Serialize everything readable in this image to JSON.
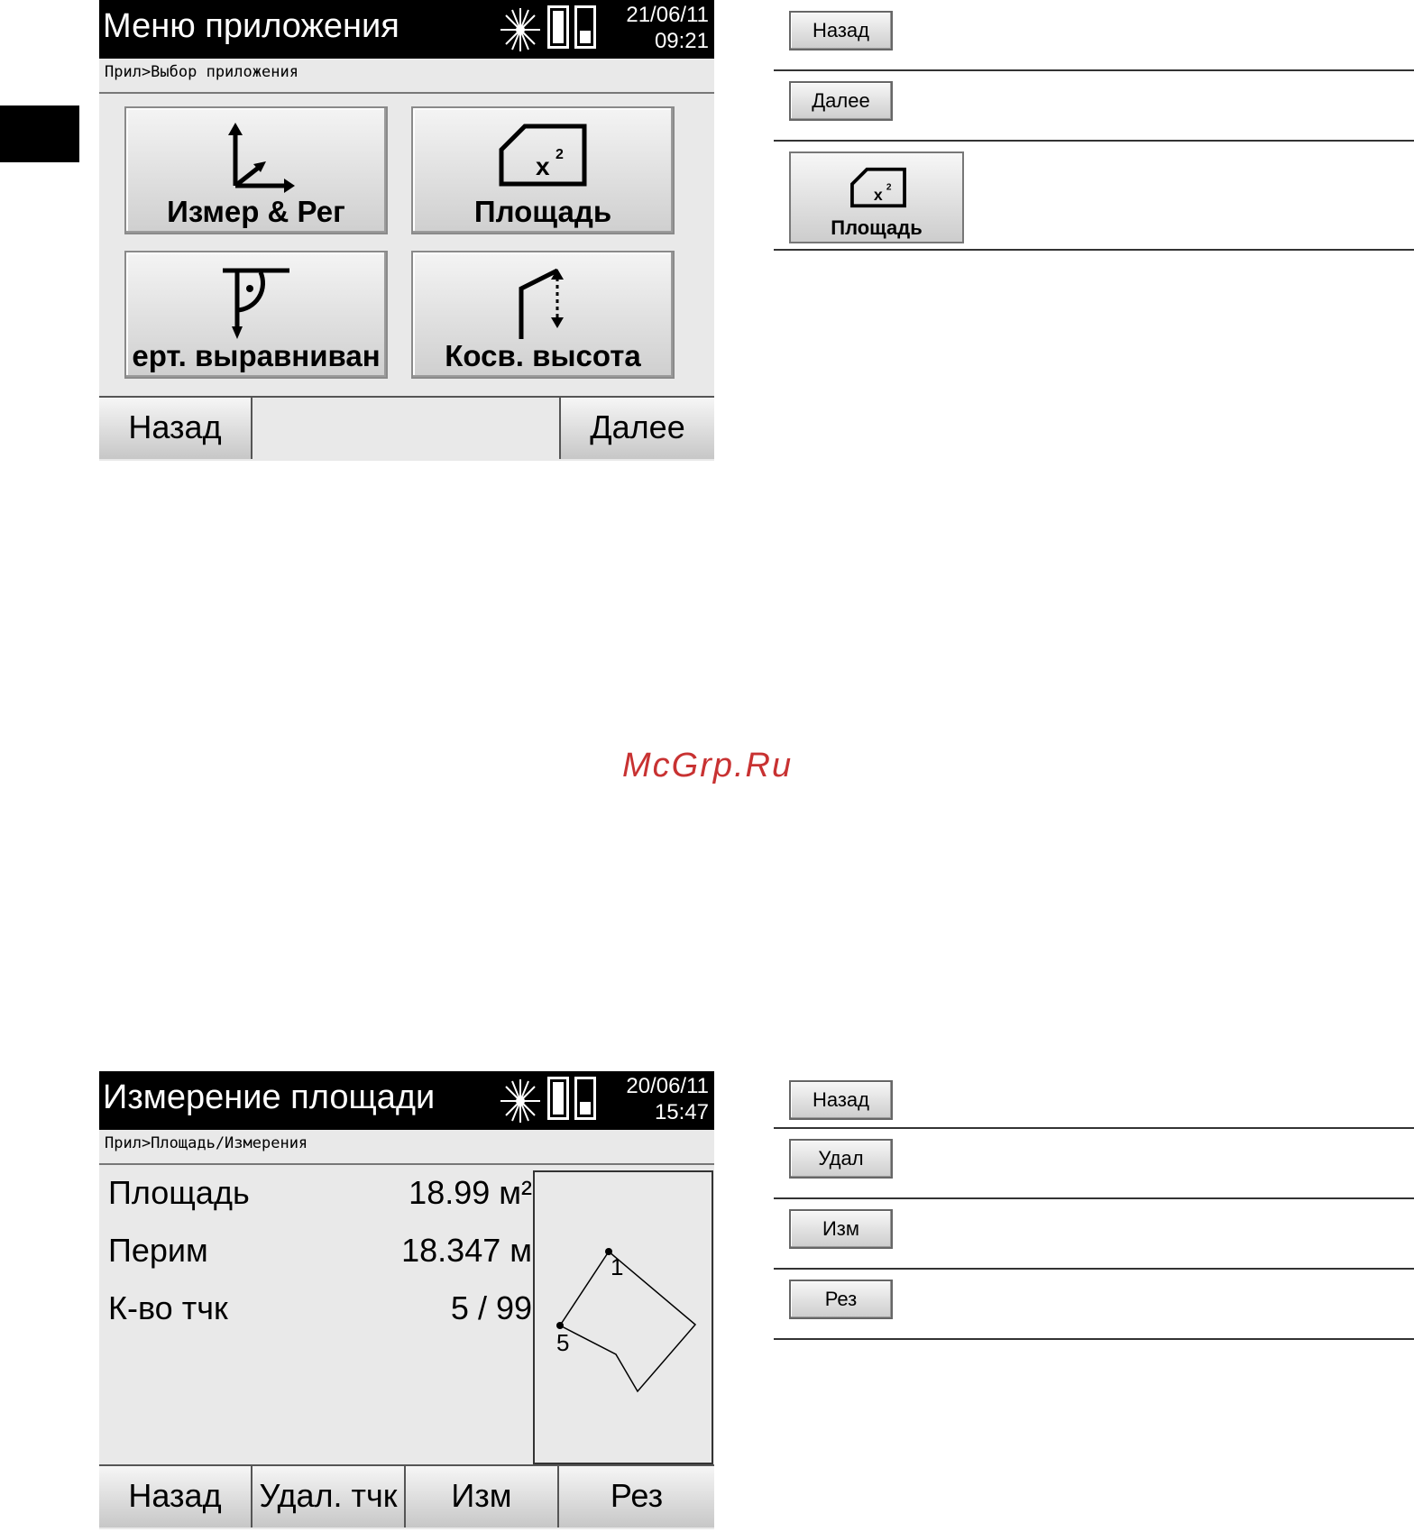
{
  "screen1": {
    "title": "Меню приложения",
    "date": "21/06/11",
    "time": "09:21",
    "breadcrumb": "Прил>Выбор приложения",
    "tiles": [
      {
        "label": "Измер & Рег",
        "icon": "axes-icon"
      },
      {
        "label": "Площадь",
        "icon": "area-icon"
      },
      {
        "label": "ерт. выравниван",
        "icon": "plumb-icon"
      },
      {
        "label": "Косв. высота",
        "icon": "indirect-height-icon"
      }
    ],
    "softkeys": {
      "back": "Назад",
      "next": "Далее"
    }
  },
  "screen2": {
    "title": "Измерение площади",
    "date": "20/06/11",
    "time": "15:47",
    "breadcrumb": "Прил>Площадь/Измерения",
    "rows": [
      {
        "label": "Площадь",
        "value": "18.99  м²"
      },
      {
        "label": "Перим",
        "value": "18.347 м"
      },
      {
        "label": "К-во тчк",
        "value": "5 / 99"
      }
    ],
    "plot_points": {
      "first": "1",
      "last": "5"
    },
    "softkeys": {
      "back": "Назад",
      "delete": "Удал. тчк",
      "measure": "Изм",
      "result": "Рез"
    }
  },
  "legend_top": {
    "back": "Назад",
    "next": "Далее",
    "area_tile": "Площадь"
  },
  "legend_bottom": {
    "back": "Назад",
    "delete": "Удал",
    "measure": "Изм",
    "result": "Рез"
  },
  "watermark": "McGrp.Ru"
}
